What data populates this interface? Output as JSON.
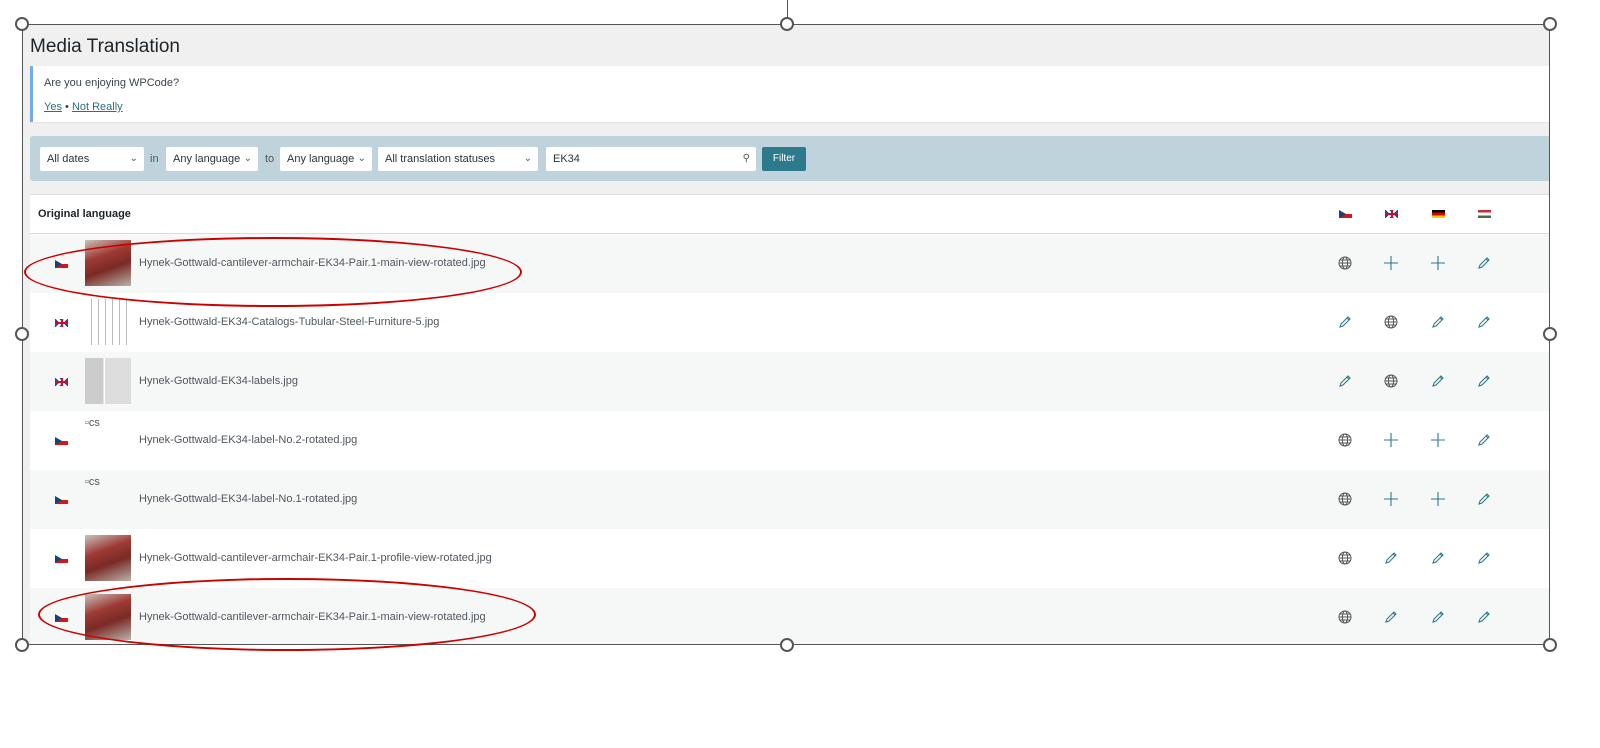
{
  "page": {
    "title": "Media Translation"
  },
  "notice": {
    "question": "Are you enjoying WPCode?",
    "yes": "Yes",
    "separator": "•",
    "no": "Not Really"
  },
  "filters": {
    "dates": "All dates",
    "in_label": "in",
    "from_lang": "Any language",
    "to_label": "to",
    "to_lang": "Any language",
    "status": "All translation statuses",
    "search_value": "EK34",
    "filter_button": "Filter"
  },
  "table": {
    "header": "Original language",
    "languages": [
      "cz",
      "gb",
      "de",
      "hu"
    ],
    "rows": [
      {
        "flag": "cz",
        "thumb": "chair",
        "file": "Hynek-Gottwald-cantilever-armchair-EK34-Pair.1-main-view-rotated.jpg",
        "actions": [
          "globe",
          "plus",
          "plus",
          "pencil"
        ]
      },
      {
        "flag": "gb",
        "thumb": "catalog",
        "file": "Hynek-Gottwald-EK34-Catalogs-Tubular-Steel-Furniture-5.jpg",
        "actions": [
          "pencil",
          "globe",
          "pencil",
          "pencil"
        ]
      },
      {
        "flag": "gb",
        "thumb": "labels",
        "file": "Hynek-Gottwald-EK34-labels.jpg",
        "actions": [
          "pencil",
          "globe",
          "pencil",
          "pencil"
        ]
      },
      {
        "flag": "cz",
        "thumb": "broken",
        "alt": "cs",
        "file": "Hynek-Gottwald-EK34-label-No.2-rotated.jpg",
        "actions": [
          "globe",
          "plus",
          "plus",
          "pencil"
        ]
      },
      {
        "flag": "cz",
        "thumb": "broken",
        "alt": "cs",
        "file": "Hynek-Gottwald-EK34-label-No.1-rotated.jpg",
        "actions": [
          "globe",
          "plus",
          "plus",
          "pencil"
        ]
      },
      {
        "flag": "cz",
        "thumb": "chair",
        "file": "Hynek-Gottwald-cantilever-armchair-EK34-Pair.1-profile-view-rotated.jpg",
        "actions": [
          "globe",
          "pencil",
          "pencil",
          "pencil"
        ]
      },
      {
        "flag": "cz",
        "thumb": "chair",
        "file": "Hynek-Gottwald-cantilever-armchair-EK34-Pair.1-main-view-rotated.jpg",
        "actions": [
          "globe",
          "pencil",
          "pencil",
          "pencil"
        ]
      }
    ]
  },
  "colors": {
    "accent": "#2c7a8c",
    "annotation": "#cc0000",
    "filter_bar": "#bfd3dc"
  }
}
